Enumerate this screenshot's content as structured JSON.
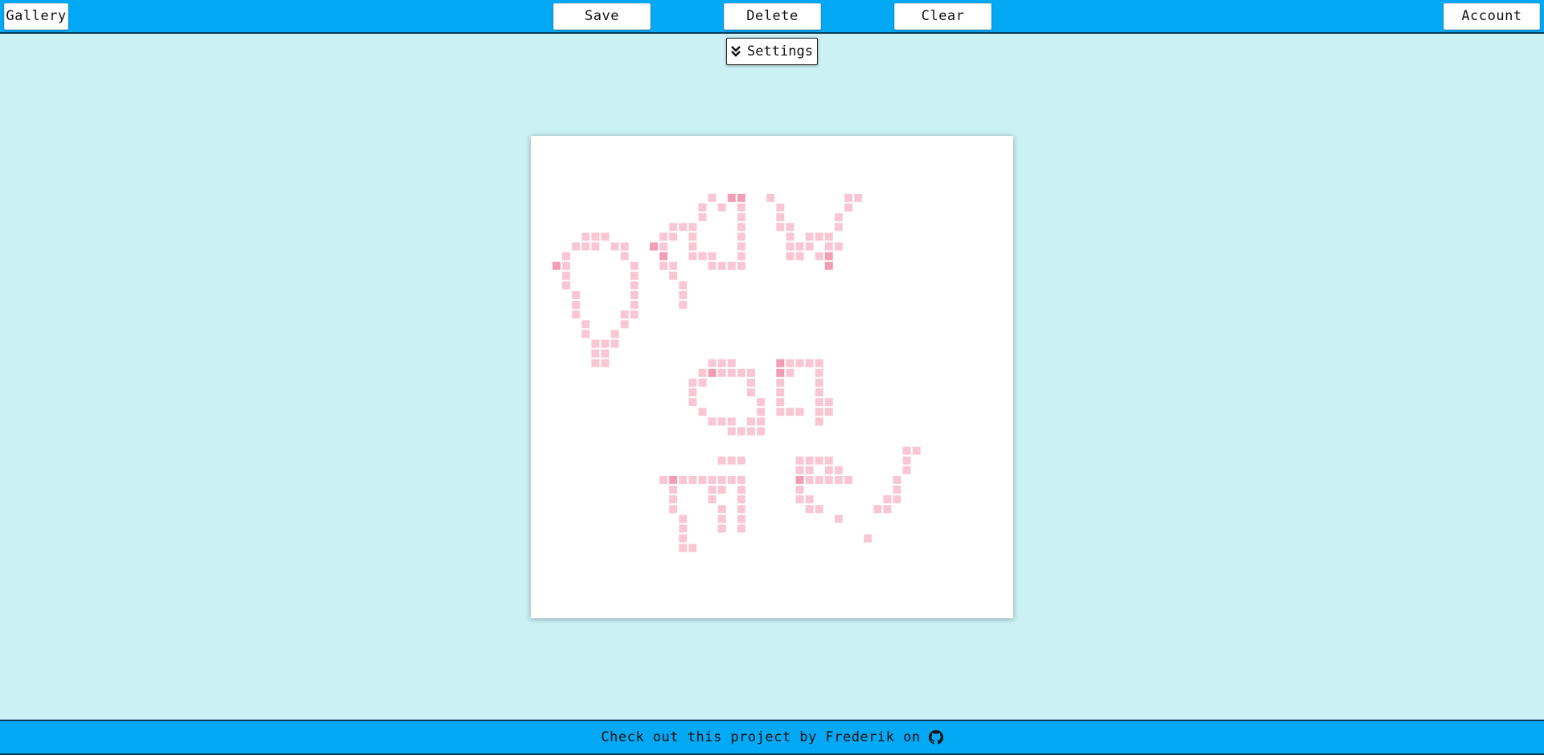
{
  "topbar": {
    "gallery_label": "Gallery",
    "save_label": "Save",
    "delete_label": "Delete",
    "clear_label": "Clear",
    "account_label": "Account"
  },
  "settings": {
    "label": "Settings",
    "icon": "double-chevron-down-icon"
  },
  "canvas": {
    "pixel_color": "#f9c6d4",
    "pixel_color_dark": "#f29db4",
    "text": "draw on me!"
  },
  "footer": {
    "text": "Check out this project by Frederik on",
    "icon": "github-icon"
  },
  "colors": {
    "bar": "#03a9f4",
    "background": "#cbf1f5",
    "canvas": "#ffffff"
  }
}
